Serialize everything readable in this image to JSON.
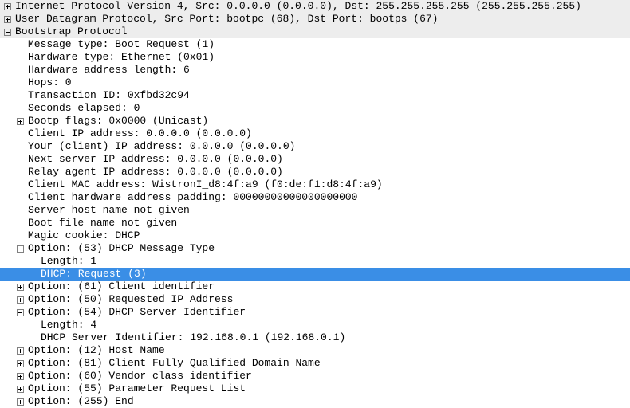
{
  "colors": {
    "headerBg": "#ededed",
    "selectionBg": "#3a8ee6"
  },
  "icons": {
    "plus": "+",
    "minus": "-"
  },
  "rows": [
    {
      "indent": 0,
      "toggle": "plus",
      "header": true,
      "key": "ipv4",
      "text": "Internet Protocol Version 4, Src: 0.0.0.0 (0.0.0.0), Dst: 255.255.255.255 (255.255.255.255)"
    },
    {
      "indent": 0,
      "toggle": "plus",
      "header": true,
      "key": "udp",
      "text": "User Datagram Protocol, Src Port: bootpc (68), Dst Port: bootps (67)"
    },
    {
      "indent": 0,
      "toggle": "minus",
      "header": true,
      "key": "bootp",
      "text": "Bootstrap Protocol"
    },
    {
      "indent": 1,
      "toggle": null,
      "key": "msgtype",
      "text": "Message type: Boot Request (1)"
    },
    {
      "indent": 1,
      "toggle": null,
      "key": "hwtype",
      "text": "Hardware type: Ethernet (0x01)"
    },
    {
      "indent": 1,
      "toggle": null,
      "key": "hwlen",
      "text": "Hardware address length: 6"
    },
    {
      "indent": 1,
      "toggle": null,
      "key": "hops",
      "text": "Hops: 0"
    },
    {
      "indent": 1,
      "toggle": null,
      "key": "xid",
      "text": "Transaction ID: 0xfbd32c94"
    },
    {
      "indent": 1,
      "toggle": null,
      "key": "secs",
      "text": "Seconds elapsed: 0"
    },
    {
      "indent": 1,
      "toggle": "plus",
      "key": "flags",
      "text": "Bootp flags: 0x0000 (Unicast)"
    },
    {
      "indent": 1,
      "toggle": null,
      "key": "ciaddr",
      "text": "Client IP address: 0.0.0.0 (0.0.0.0)"
    },
    {
      "indent": 1,
      "toggle": null,
      "key": "yiaddr",
      "text": "Your (client) IP address: 0.0.0.0 (0.0.0.0)"
    },
    {
      "indent": 1,
      "toggle": null,
      "key": "siaddr",
      "text": "Next server IP address: 0.0.0.0 (0.0.0.0)"
    },
    {
      "indent": 1,
      "toggle": null,
      "key": "giaddr",
      "text": "Relay agent IP address: 0.0.0.0 (0.0.0.0)"
    },
    {
      "indent": 1,
      "toggle": null,
      "key": "chaddr",
      "text": "Client MAC address: WistronI_d8:4f:a9 (f0:de:f1:d8:4f:a9)"
    },
    {
      "indent": 1,
      "toggle": null,
      "key": "chpad",
      "text": "Client hardware address padding: 00000000000000000000"
    },
    {
      "indent": 1,
      "toggle": null,
      "key": "sname",
      "text": "Server host name not given"
    },
    {
      "indent": 1,
      "toggle": null,
      "key": "file",
      "text": "Boot file name not given"
    },
    {
      "indent": 1,
      "toggle": null,
      "key": "magic",
      "text": "Magic cookie: DHCP"
    },
    {
      "indent": 1,
      "toggle": "minus",
      "key": "opt53",
      "text": "Option: (53) DHCP Message Type"
    },
    {
      "indent": 2,
      "toggle": null,
      "key": "opt53len",
      "text": "Length: 1"
    },
    {
      "indent": 2,
      "toggle": null,
      "selected": true,
      "key": "opt53val",
      "text": "DHCP: Request (3)"
    },
    {
      "indent": 1,
      "toggle": "plus",
      "key": "opt61",
      "text": "Option: (61) Client identifier"
    },
    {
      "indent": 1,
      "toggle": "plus",
      "key": "opt50",
      "text": "Option: (50) Requested IP Address"
    },
    {
      "indent": 1,
      "toggle": "minus",
      "key": "opt54",
      "text": "Option: (54) DHCP Server Identifier"
    },
    {
      "indent": 2,
      "toggle": null,
      "key": "opt54len",
      "text": "Length: 4"
    },
    {
      "indent": 2,
      "toggle": null,
      "key": "opt54val",
      "text": "DHCP Server Identifier: 192.168.0.1 (192.168.0.1)"
    },
    {
      "indent": 1,
      "toggle": "plus",
      "key": "opt12",
      "text": "Option: (12) Host Name"
    },
    {
      "indent": 1,
      "toggle": "plus",
      "key": "opt81",
      "text": "Option: (81) Client Fully Qualified Domain Name"
    },
    {
      "indent": 1,
      "toggle": "plus",
      "key": "opt60",
      "text": "Option: (60) Vendor class identifier"
    },
    {
      "indent": 1,
      "toggle": "plus",
      "key": "opt55",
      "text": "Option: (55) Parameter Request List"
    },
    {
      "indent": 1,
      "toggle": "plus",
      "key": "opt255",
      "text": "Option: (255) End"
    }
  ]
}
